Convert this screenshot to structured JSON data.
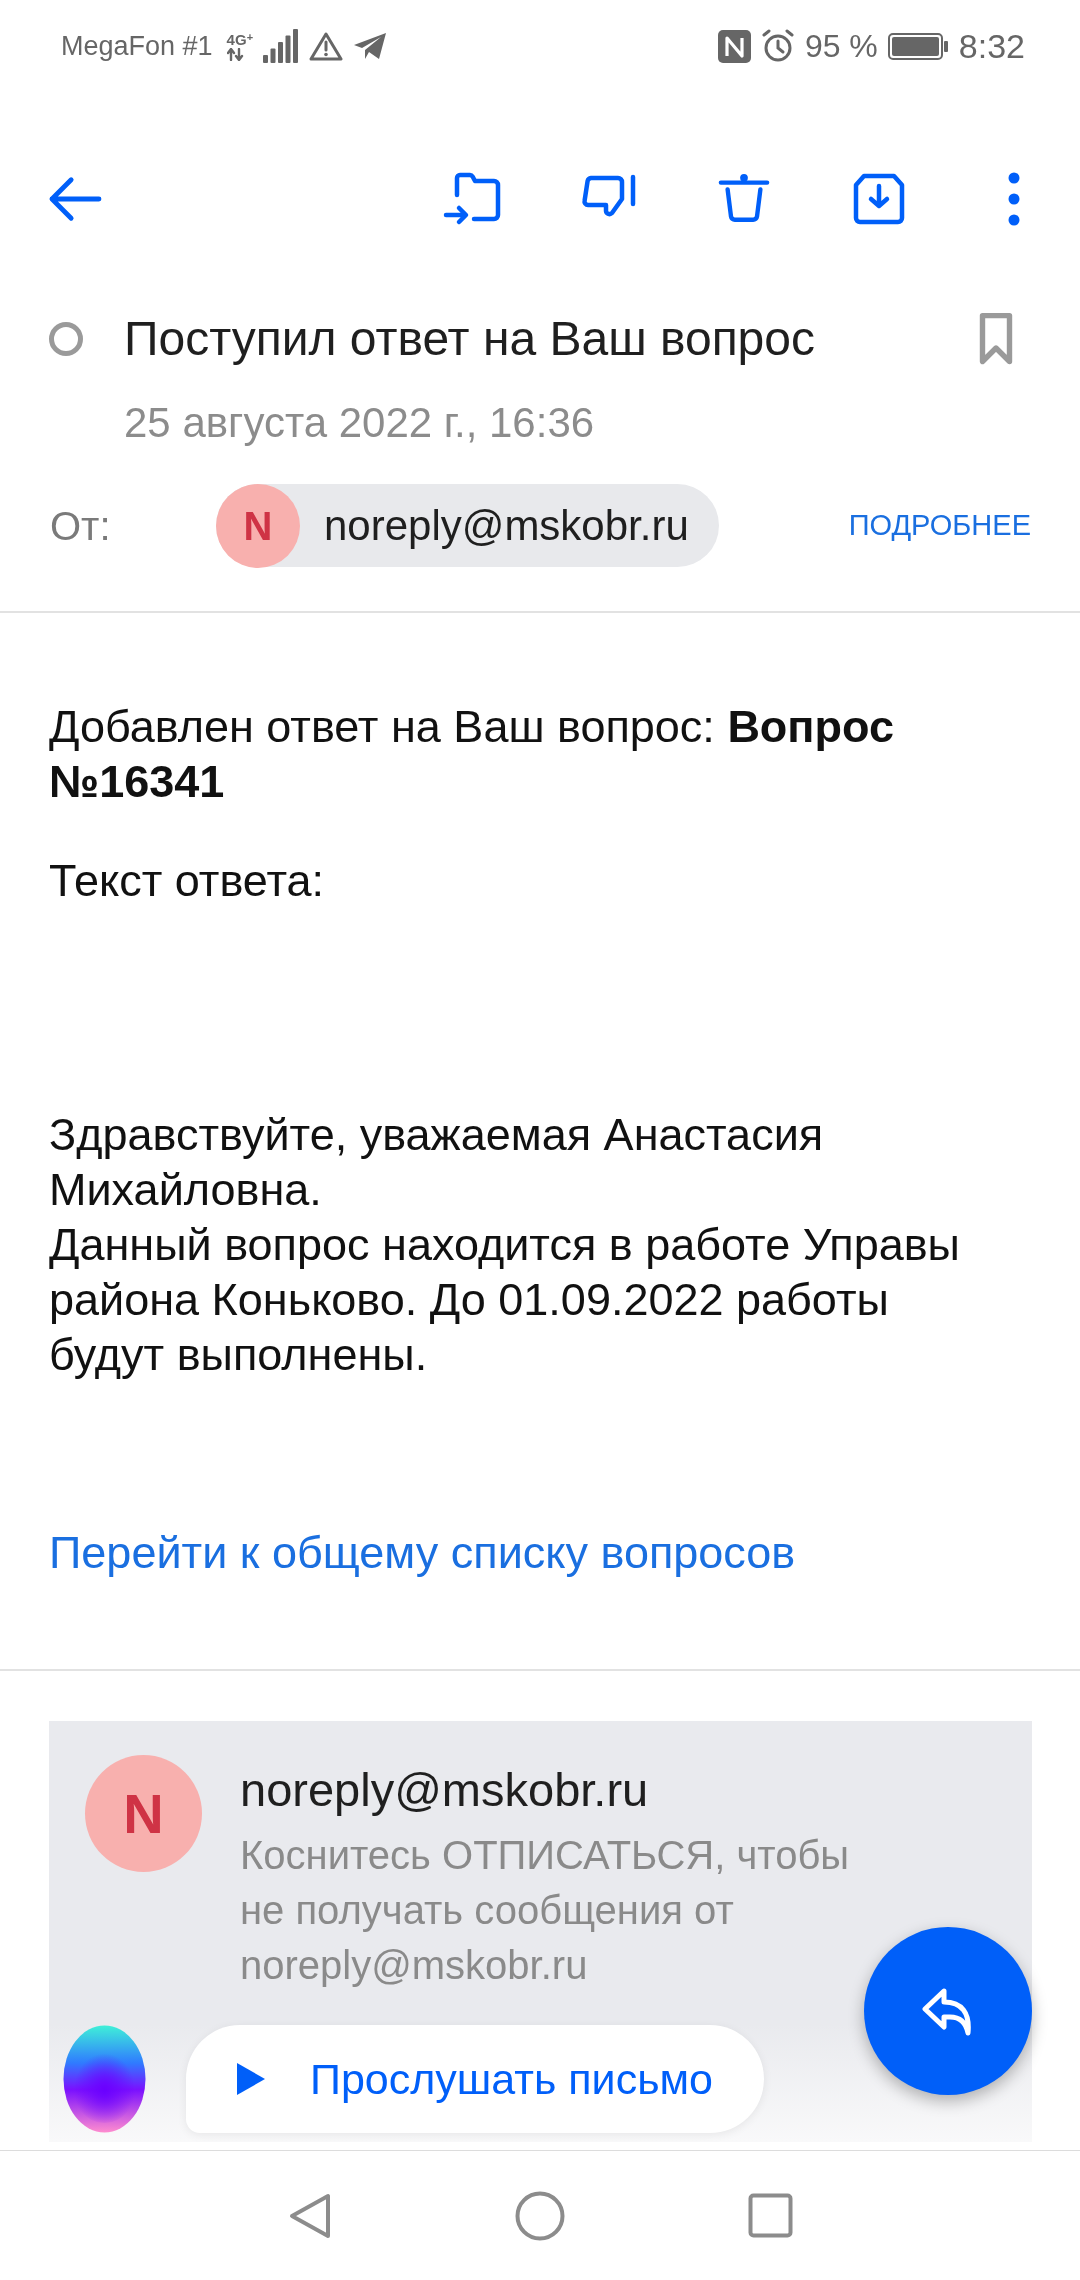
{
  "status_bar": {
    "carrier": "MegaFon #1",
    "network_type": "4G$^{+}$",
    "battery_percent": "95 %",
    "time": "8:32"
  },
  "message": {
    "unread": false,
    "title": "Поступил ответ на Ваш вопрос",
    "flagged": false,
    "date": "25 августа 2022 г., 16:36",
    "from_label": "От:",
    "sender": {
      "initial": "N",
      "email": "noreply@mskobr.ru"
    },
    "details_link": "ПОДРОБНЕЕ"
  },
  "body": {
    "intro": "Добавлен ответ на Ваш вопрос: **Вопрос №16341**",
    "answer_label": "Текст ответа:",
    "answer_paragraphs": [
      "Здравствуйте, уважаемая Анастасия Михайловна.",
      "Данный вопрос находится в работе Управы района Коньково. До 01.09.2022 работы будут выполнены."
    ],
    "link": "Перейти к общему списку вопросов"
  },
  "unsubscribe_card": {
    "initial": "N",
    "email": "noreply@mskobr.ru",
    "notice": "Коснитесь ОТПИСАТЬСЯ, чтобы не получать сообщения от noreply@mskobr.ru"
  },
  "listen_button": {
    "label": "Прослушать письмо"
  }
}
